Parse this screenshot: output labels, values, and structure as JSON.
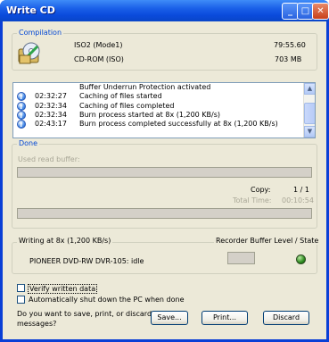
{
  "window": {
    "title": "Write CD",
    "minimize_glyph": "_",
    "maximize_glyph": "□",
    "close_glyph": "✕"
  },
  "compilation": {
    "legend": "Compilation",
    "name": "ISO2 (Mode1)",
    "type": "CD-ROM (ISO)",
    "duration": "79:55.60",
    "size": "703 MB",
    "icon": "cd-compilation-icon"
  },
  "log": {
    "rows": [
      {
        "time": "",
        "message": "Buffer Underrun Protection activated"
      },
      {
        "time": "02:32:27",
        "message": "Caching of files started"
      },
      {
        "time": "02:32:34",
        "message": "Caching of files completed"
      },
      {
        "time": "02:32:34",
        "message": "Burn process started at 8x (1,200 KB/s)"
      },
      {
        "time": "02:43:17",
        "message": "Burn process completed successfully at 8x (1,200 KB/s)"
      }
    ],
    "info_icon": "info-icon"
  },
  "done": {
    "legend": "Done",
    "used_read_buffer_label": "Used read buffer:",
    "copy_label": "Copy:",
    "copy_value": "1 / 1",
    "total_time_label": "Total Time:",
    "total_time_value": "00:10:54"
  },
  "writing": {
    "speed_label": "Writing at 8x (1,200 KB/s)",
    "recorder_label": "Recorder Buffer Level / State",
    "drive": "PIONEER DVD-RW  DVR-105: idle",
    "state_color": "#2c8a1e"
  },
  "options": {
    "verify_label": "Verify written data",
    "verify_checked": false,
    "shutdown_label": "Automatically shut down the PC when done",
    "shutdown_checked": false,
    "question_line1": "Do you want to save, print, or discard",
    "question_line2": "messages?"
  },
  "buttons": {
    "save": "Save...",
    "print": "Print...",
    "discard": "Discard"
  }
}
